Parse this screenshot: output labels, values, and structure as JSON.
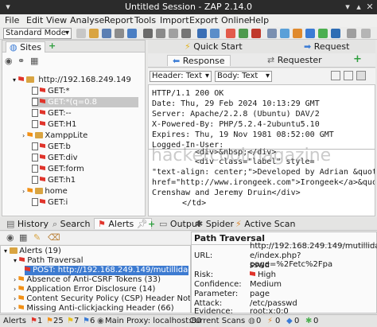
{
  "window": {
    "title": "Untitled Session - ZAP 2.14.0"
  },
  "menu": [
    "File",
    "Edit",
    "View",
    "Analyse",
    "Report",
    "Tools",
    "Import",
    "Export",
    "Online",
    "Help"
  ],
  "toolbar": {
    "mode": "Standard Mode"
  },
  "sites_tab": {
    "label": "Sites"
  },
  "quick_start": "Quick Start",
  "request_tab": "Request",
  "response_tab": "Response",
  "requester_tab": "Requester",
  "tree": {
    "root": "http://192.168.249.149",
    "items": [
      "GET:*",
      "GET:*(q=0.8",
      "GET:--",
      "GET:H1",
      "XamppLite",
      "GET:b",
      "GET:div",
      "GET:form",
      "GET:h1",
      "home",
      "GET:i"
    ]
  },
  "view_selects": {
    "header": "Header: Text",
    "body": "Body: Text"
  },
  "response": {
    "headers": [
      "HTTP/1.1 200 OK",
      "Date: Thu, 29 Feb 2024 10:13:29 GMT",
      "Server: Apache/2.2.8 (Ubuntu) DAV/2",
      "X-Powered-By: PHP/5.2.4-2ubuntu5.10",
      "Expires: Thu, 19 Nov 1981 08:52:00 GMT",
      "Logged-In-User:"
    ],
    "body": [
      "<div>&nbsp;</div>",
      "<div class=\"label\" style=",
      "\"text-align: center;\">Developed by Adrian &quot;<a",
      "href=\"http://www.irongeek.com\">Irongeek</a>&quot;",
      "Crenshaw and Jeremy Druin</div>",
      "</td>"
    ]
  },
  "bottom_tabs": {
    "history": "History",
    "search": "Search",
    "alerts": "Alerts",
    "output": "Output",
    "spider": "Spider",
    "active_scan": "Active Scan"
  },
  "alerts": {
    "root": "Alerts (19)",
    "items": [
      "Path Traversal",
      "POST: http://192.168.249.149/mutillidae/",
      "Absence of Anti-CSRF Tokens (33)",
      "Application Error Disclosure (14)",
      "Content Security Policy (CSP) Header Not Set",
      "Missing Anti-clickjacking Header (66)"
    ]
  },
  "detail": {
    "title": "Path Traversal",
    "url_label": "URL:",
    "url_value": [
      "http://192.168.249.149/mutillida",
      "e/index.php?page=%2Fetc%2Fpa",
      "sswd"
    ],
    "risk_label": "Risk:",
    "risk_value": "High",
    "confidence_label": "Confidence:",
    "confidence_value": "Medium",
    "parameter_label": "Parameter:",
    "parameter_value": "page",
    "attack_label": "Attack:",
    "attack_value": "/etc/passwd",
    "evidence_label": "Evidence:",
    "evidence_value": "root:x:0:0"
  },
  "status": {
    "alerts_label": "Alerts",
    "counts": [
      "1",
      "25",
      "7",
      "6"
    ],
    "main_proxy": "Main Proxy: localhost:80",
    "current_scans": "Current Scans",
    "scan_counts": [
      "0",
      "0",
      "0",
      "0"
    ]
  },
  "watermark": "hackercoolmagazine",
  "colors": {
    "high": "#e0342b",
    "medium": "#f29016",
    "selected": "#3d7bd1"
  }
}
